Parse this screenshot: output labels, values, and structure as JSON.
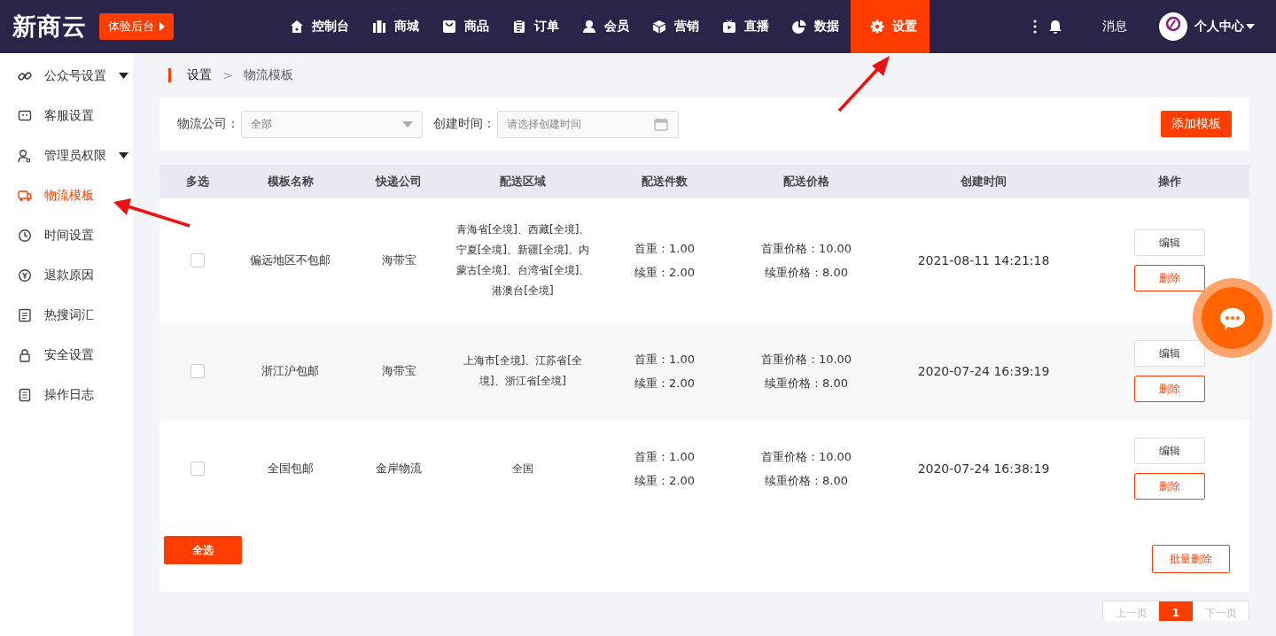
{
  "header": {
    "logo": "新商云",
    "trial_button": "体验后台",
    "nav": [
      {
        "label": "控制台",
        "selected": false
      },
      {
        "label": "商城",
        "selected": false
      },
      {
        "label": "商品",
        "selected": false
      },
      {
        "label": "订单",
        "selected": false
      },
      {
        "label": "会员",
        "selected": false
      },
      {
        "label": "营销",
        "selected": false
      },
      {
        "label": "直播",
        "selected": false
      },
      {
        "label": "数据",
        "selected": false
      },
      {
        "label": "设置",
        "selected": true
      }
    ],
    "messages": "消息",
    "user_menu": "个人中心"
  },
  "sidebar": {
    "items": [
      {
        "label": "公众号设置",
        "selected": false,
        "expandable": true
      },
      {
        "label": "客服设置",
        "selected": false,
        "expandable": false
      },
      {
        "label": "管理员权限",
        "selected": false,
        "expandable": true
      },
      {
        "label": "物流模板",
        "selected": true,
        "expandable": false
      },
      {
        "label": "时间设置",
        "selected": false,
        "expandable": false
      },
      {
        "label": "退款原因",
        "selected": false,
        "expandable": false
      },
      {
        "label": "热搜词汇",
        "selected": false,
        "expandable": false
      },
      {
        "label": "安全设置",
        "selected": false,
        "expandable": false
      },
      {
        "label": "操作日志",
        "selected": false,
        "expandable": false
      }
    ]
  },
  "breadcrumb": {
    "items": [
      "设置",
      "物流模板"
    ],
    "separator": ">"
  },
  "filters": [
    {
      "kind": "select",
      "label": "物流公司：",
      "value": "全部"
    },
    {
      "kind": "date",
      "label": "创建时间：",
      "placeholder": "请选择创建时间"
    }
  ],
  "add_button": "添加模板",
  "table": {
    "columns": [
      "多选",
      "模板名称",
      "快递公司",
      "配送区域",
      "配送件数",
      "配送价格",
      "创建时间",
      "操作"
    ],
    "rows": [
      {
        "checked": false,
        "name": "偏远地区不包邮",
        "company": "海带宝",
        "region": "青海省[全境]、西藏[全境]、宁夏[全境]、新疆[全境]、内蒙古[全境]、台湾省[全境]、港澳台[全境]",
        "count": [
          "首重：1.00",
          "续重：2.00"
        ],
        "price": [
          "首重价格：10.00",
          "续重价格：8.00"
        ],
        "created": "2021-08-11 14:21:18",
        "actions": [
          "编辑",
          "删除"
        ]
      },
      {
        "checked": false,
        "name": "浙江沪包邮",
        "company": "海带宝",
        "region": "上海市[全境]、江苏省[全境]、浙江省[全境]",
        "count": [
          "首重：1.00",
          "续重：2.00"
        ],
        "price": [
          "首重价格：10.00",
          "续重价格：8.00"
        ],
        "created": "2020-07-24 16:39:19",
        "actions": [
          "编辑",
          "删除"
        ]
      },
      {
        "checked": false,
        "name": "全国包邮",
        "company": "金岸物流",
        "region": "全国",
        "count": [
          "首重：1.00",
          "续重：2.00"
        ],
        "price": [
          "首重价格：10.00",
          "续重价格：8.00"
        ],
        "created": "2020-07-24 16:38:19",
        "actions": [
          "编辑",
          "删除"
        ]
      }
    ]
  },
  "select_all": "全选",
  "bulk_delete": "批量删除",
  "pagination": {
    "prev": "上一页",
    "pages": [
      {
        "label": "1",
        "selected": true
      }
    ],
    "next": "下一页"
  }
}
